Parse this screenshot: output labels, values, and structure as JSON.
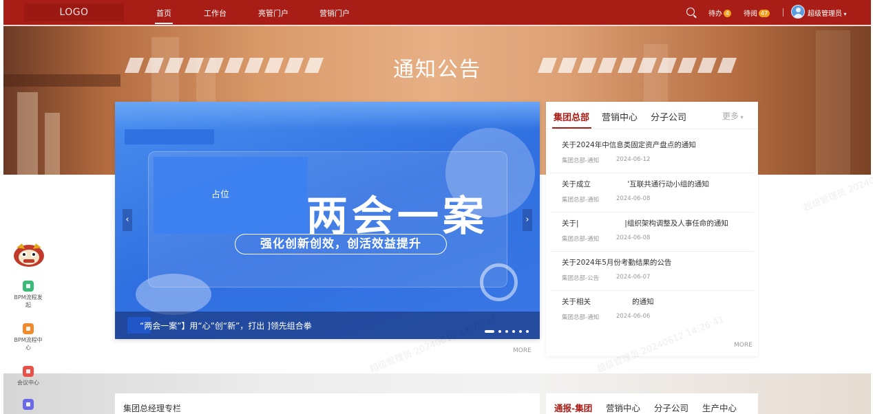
{
  "nav": {
    "logo": "LOGO",
    "links": [
      "首页",
      "工作台",
      "亮管门户",
      "营销门户"
    ],
    "todo_label": "待办",
    "todo_count": "4",
    "toread_label": "待阅",
    "toread_count": "47",
    "user": "超级管理员"
  },
  "hero": {
    "title": "通知公告"
  },
  "carousel": {
    "placeholder": "占位",
    "slogan": "两会一案",
    "subslogan": "强化创新创效，创活效益提升",
    "caption": "“两会一案”】用“心”创“新”，打出        ]领先组合拳",
    "prev": "‹",
    "next": "›",
    "more": "MORE"
  },
  "notices": {
    "tabs": [
      "集团总部",
      "营销中心",
      "分子公司"
    ],
    "more_tabs": "更多",
    "items": [
      {
        "title": "关于2024年中信息类固定资产盘点的通知",
        "category": "集团总部-通知",
        "date": "2024-06-12"
      },
      {
        "title": "关于成立                '互联共通行动小组的通知",
        "category": "集团总部-通知",
        "date": "2024-06-08"
      },
      {
        "title": "关于|                    |组织架构调整及人事任命的通知",
        "category": "集团总部-通知",
        "date": "2024-06-08"
      },
      {
        "title": "关于2024年5月份考勤结果的公告",
        "category": "集团总部-公告",
        "date": "2024-06-07"
      },
      {
        "title": "关于相关                  的通知",
        "category": "集团总部-通知",
        "date": "2024-06-06"
      }
    ],
    "more": "MORE"
  },
  "sidebar": {
    "items": [
      {
        "label": "BPM流程发起",
        "color": "#3cb878"
      },
      {
        "label": "BPM流程中心",
        "color": "#f08a2c"
      },
      {
        "label": "会议中心",
        "color": "#e8504a"
      },
      {
        "label": "",
        "color": "#6a6ae8"
      }
    ]
  },
  "bottom": {
    "ceo_title": "集团总经理专栏",
    "bulletin_tabs": [
      "通报-集团",
      "营销中心",
      "分子公司",
      "生产中心"
    ]
  },
  "watermark": "超级管理员 20240612 14:26:41"
}
